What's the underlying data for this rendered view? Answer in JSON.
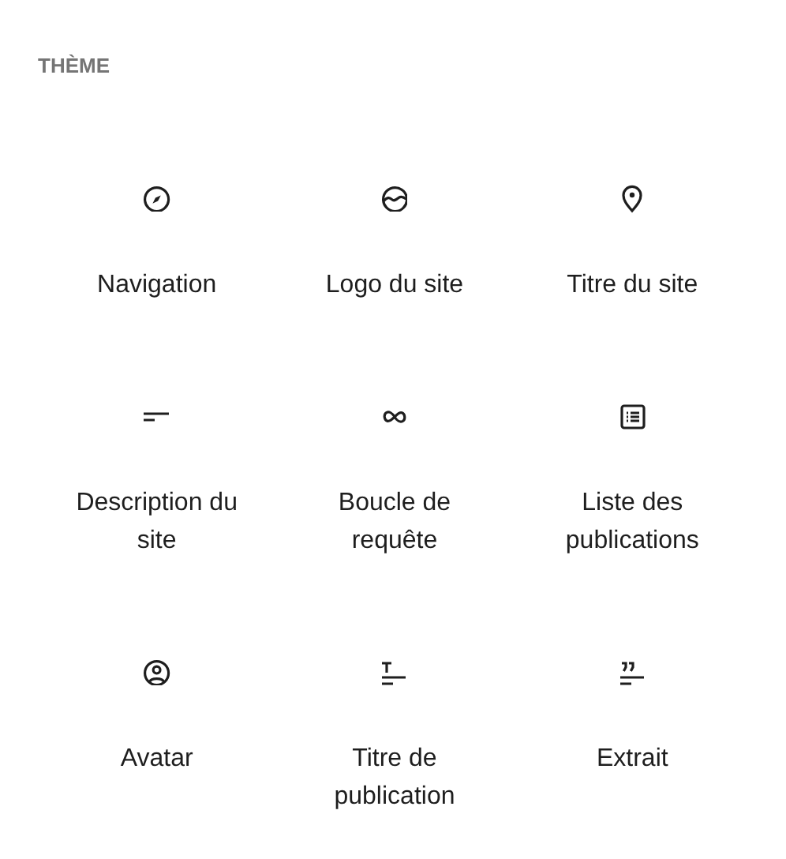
{
  "section": {
    "title": "THÈME"
  },
  "blocks": [
    {
      "label": "Navigation"
    },
    {
      "label": "Logo du site"
    },
    {
      "label": "Titre du site"
    },
    {
      "label": "Description du site"
    },
    {
      "label": "Boucle de requête"
    },
    {
      "label": "Liste des publications"
    },
    {
      "label": "Avatar"
    },
    {
      "label": "Titre de publication"
    },
    {
      "label": "Extrait"
    }
  ]
}
